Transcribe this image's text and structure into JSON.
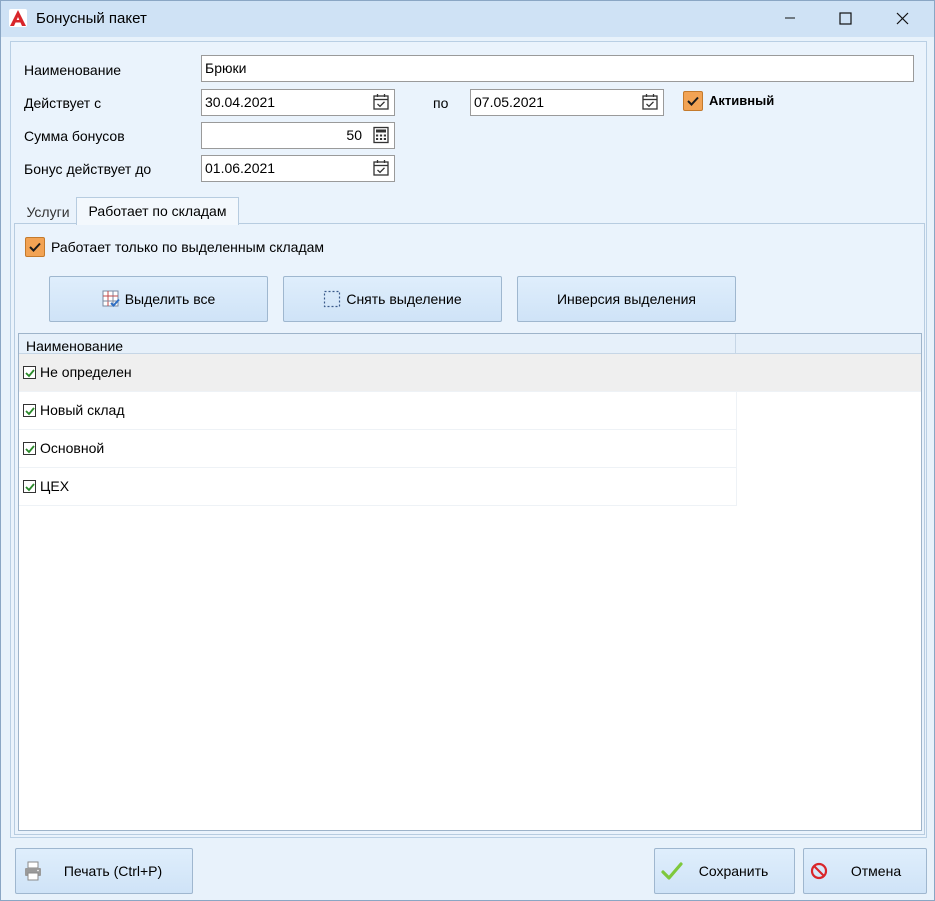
{
  "window": {
    "title": "Бонусный пакет",
    "minimize_glyph": "—",
    "maximize_glyph": "☐",
    "close_glyph": "✕"
  },
  "form": {
    "name_label": "Наименование",
    "name_value": "Брюки",
    "valid_from_label": "Действует с",
    "valid_from_value": "30.04.2021",
    "to_label": "по",
    "valid_to_value": "07.05.2021",
    "active_label": "Активный",
    "active_checked": true,
    "bonus_sum_label": "Сумма бонусов",
    "bonus_sum_value": "50",
    "bonus_until_label": "Бонус действует до",
    "bonus_until_value": "01.06.2021"
  },
  "tabs": [
    {
      "label": "Услуги",
      "active": false
    },
    {
      "label": "Работает по складам",
      "active": true
    }
  ],
  "warehouses_tab": {
    "only_selected_label": "Работает только по выделенным складам",
    "only_selected_checked": true,
    "select_all_label": "Выделить все",
    "deselect_label": "Снять выделение",
    "invert_label": "Инверсия выделения",
    "grid": {
      "column_header": "Наименование",
      "rows": [
        {
          "name": "Не определен",
          "checked": true
        },
        {
          "name": "Новый склад",
          "checked": true
        },
        {
          "name": "Основной",
          "checked": true
        },
        {
          "name": "ЦЕХ",
          "checked": true
        }
      ]
    }
  },
  "footer": {
    "print_label": "Печать (Ctrl+P)",
    "save_label": "Сохранить",
    "cancel_label": "Отмена"
  },
  "icons": {
    "app": "app-logo-icon",
    "calendar": "calendar-icon",
    "calculator": "calculator-icon",
    "select_all": "grid-select-icon",
    "deselect": "dashed-selection-icon",
    "print": "printer-icon",
    "save": "checkmark-icon",
    "cancel": "no-entry-icon"
  },
  "colors": {
    "accent_orange": "#f2a354",
    "window_bg": "#e8f2fb",
    "button_bg": "#d7e8fa",
    "save_green": "#7ec83c",
    "cancel_red": "#d9262a"
  }
}
